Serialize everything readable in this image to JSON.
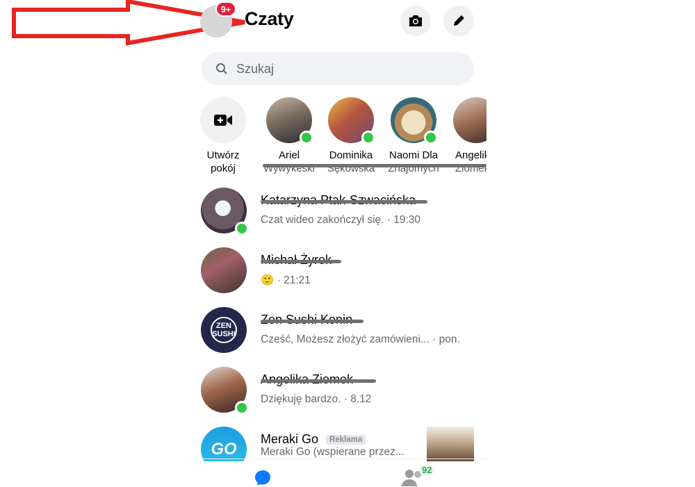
{
  "annotation": {
    "arrow_color": "#e8251f"
  },
  "header": {
    "badge": "9+",
    "title": "Czaty",
    "camera_icon": "camera-icon",
    "compose_icon": "pencil-icon"
  },
  "search": {
    "placeholder": "Szukaj"
  },
  "stories": [
    {
      "label_line1": "Utwórz",
      "label_line2": "pokój"
    },
    {
      "name": "Ariel",
      "name2": "Wywykeski"
    },
    {
      "name": "Dominika",
      "name2": "Sękowska"
    },
    {
      "name": "Naomi Dla",
      "name2": "Znajomych"
    },
    {
      "name": "Angelik",
      "name2": "Ziomek"
    }
  ],
  "chats": [
    {
      "name": "Katarzyna Ptak-Szwacińska",
      "message": "Czat wideo zakończył się. · 19:30"
    },
    {
      "name": "Michał Żyrek",
      "emoji": "🙂",
      "message": " · 21:21"
    },
    {
      "name": "Zen Sushi Konin",
      "avatar_text": "ZEN SUSHI",
      "message": "Cześć, Możesz złożyć zamówieni...",
      "time": "· pon."
    },
    {
      "name": "Angelika Ziomek",
      "message": "Dziękuję bardzo. · 8.12"
    },
    {
      "name": "Meraki Go",
      "tag": "Reklama",
      "avatar_text": "GO",
      "message": "Meraki Go (wspierane przez..."
    }
  ],
  "bottom_nav": {
    "people_badge": "92"
  },
  "colors": {
    "online": "#31c748",
    "badge": "#e41e3f",
    "messenger_blue": "#0a7cff",
    "secondary_text": "#65676b"
  }
}
